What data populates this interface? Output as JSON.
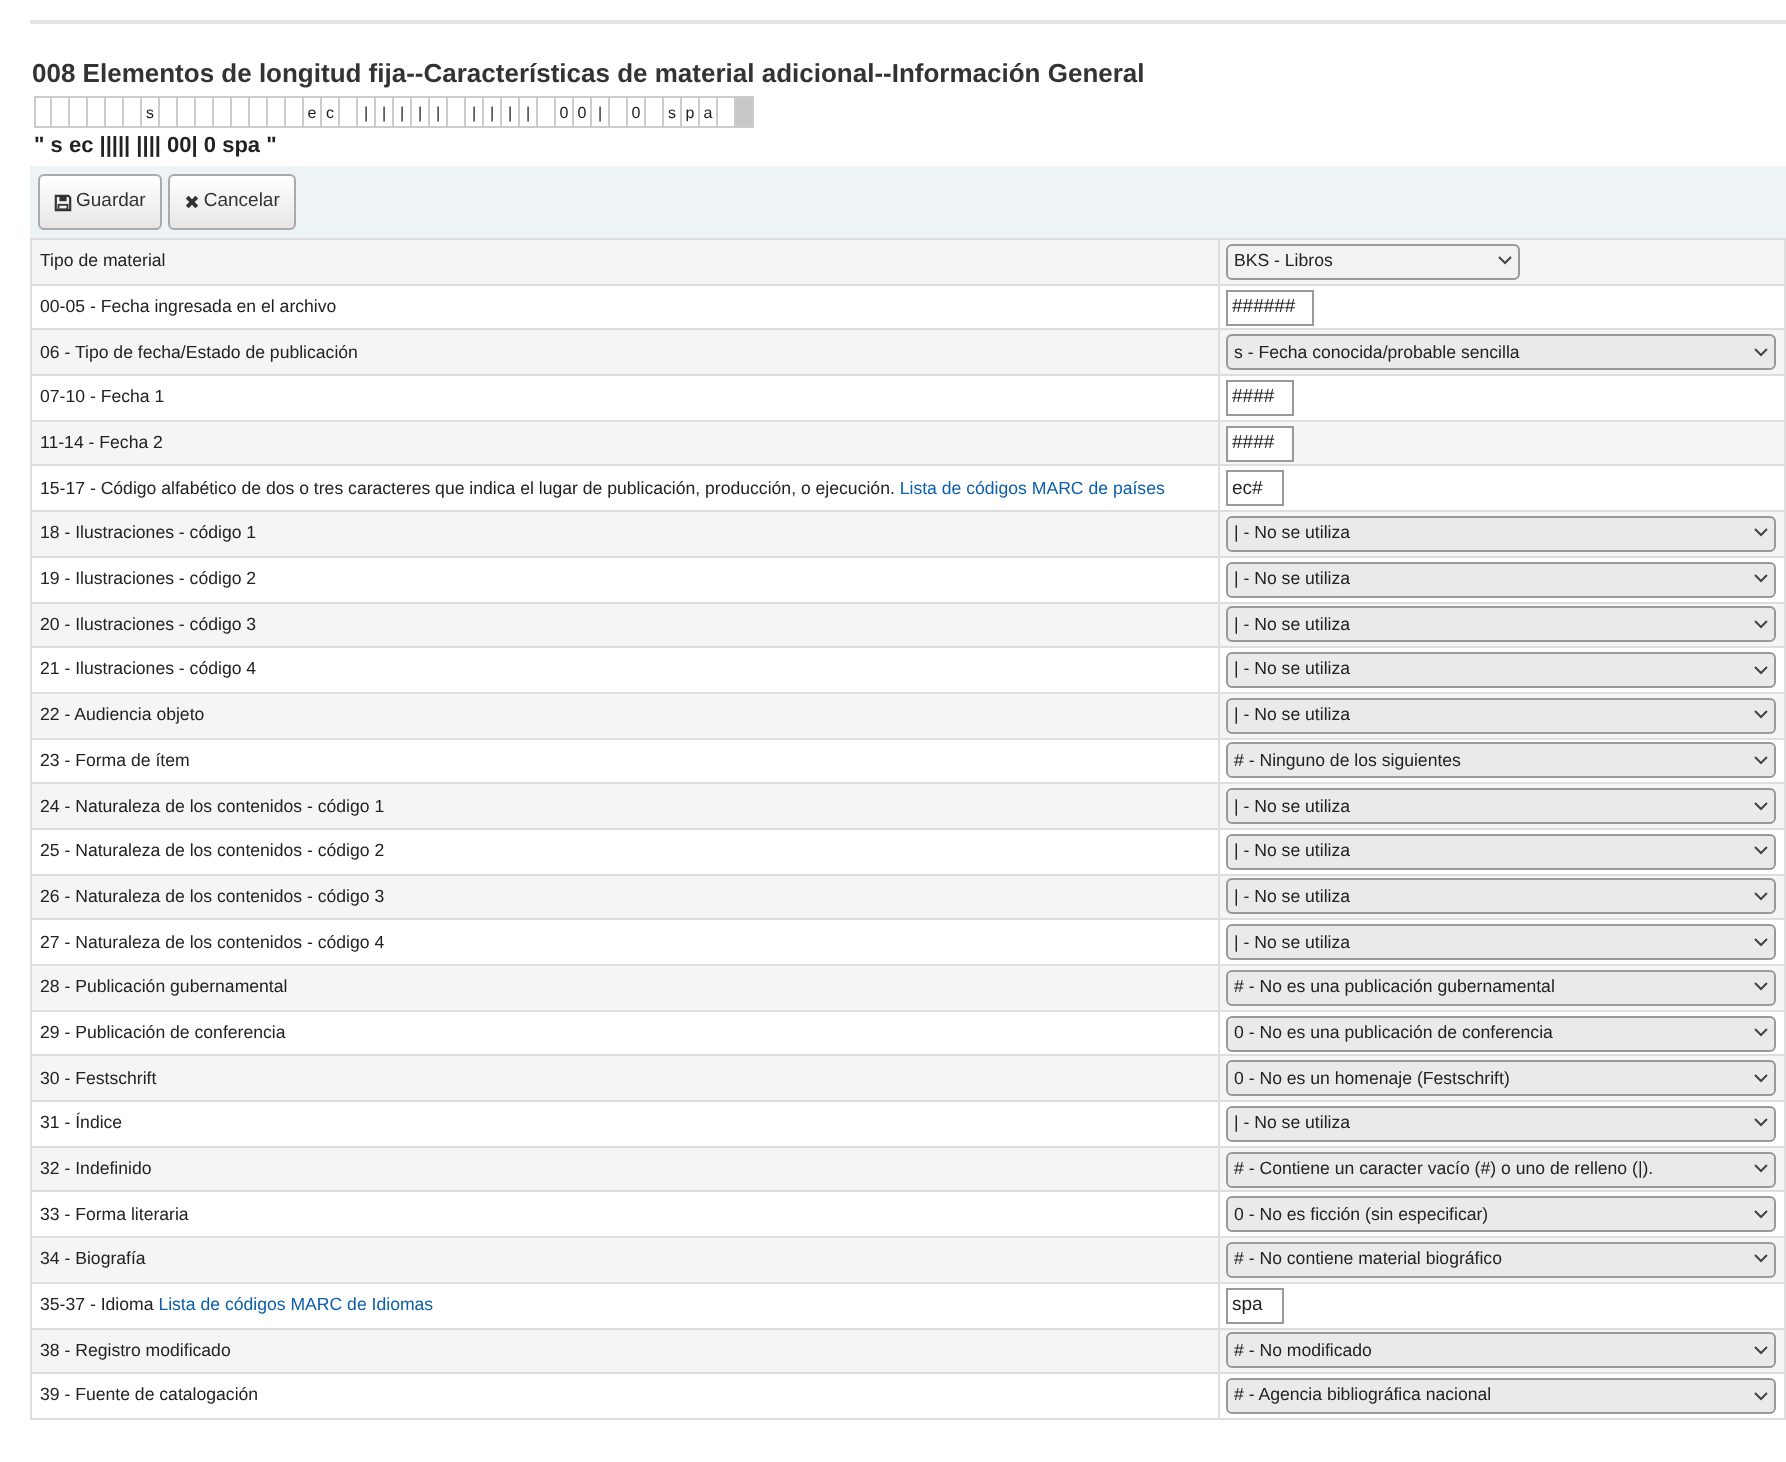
{
  "title": "008 Elementos de longitud fija--Características de material adicional--Información General",
  "cells": [
    {
      "selected": false
    },
    {
      "selected": false
    },
    {
      "selected": false
    },
    {
      "selected": false
    },
    {
      "selected": false
    },
    {
      "selected": false
    },
    {
      "char": "s",
      "selected": false
    },
    {
      "selected": false
    },
    {
      "selected": false
    },
    {
      "selected": false
    },
    {
      "selected": false
    },
    {
      "selected": false
    },
    {
      "selected": false
    },
    {
      "selected": false
    },
    {
      "selected": false
    },
    {
      "char": "e",
      "selected": false
    },
    {
      "char": "c",
      "selected": false
    },
    {
      "selected": false
    },
    {
      "char": "|",
      "selected": false
    },
    {
      "char": "|",
      "selected": false
    },
    {
      "char": "|",
      "selected": false
    },
    {
      "char": "|",
      "selected": false
    },
    {
      "char": "|",
      "selected": false
    },
    {
      "selected": false
    },
    {
      "char": "|",
      "selected": false
    },
    {
      "char": "|",
      "selected": false
    },
    {
      "char": "|",
      "selected": false
    },
    {
      "char": "|",
      "selected": false
    },
    {
      "selected": false
    },
    {
      "char": "0",
      "selected": false
    },
    {
      "char": "0",
      "selected": false
    },
    {
      "char": "|",
      "selected": false
    },
    {
      "selected": false
    },
    {
      "char": "0",
      "selected": false
    },
    {
      "selected": false
    },
    {
      "char": "s",
      "selected": false
    },
    {
      "char": "p",
      "selected": false
    },
    {
      "char": "a",
      "selected": false
    },
    {
      "selected": false
    },
    {
      "selected": true
    }
  ],
  "preview": "\" s ec ||||| |||| 00| 0 spa \"",
  "buttons": [
    {
      "kind": "save",
      "label": "Guardar"
    },
    {
      "kind": "cancel",
      "label": "Cancelar"
    }
  ],
  "rows": [
    {
      "label": "Tipo de material",
      "kind": "select-short",
      "value": "BKS - Libros"
    },
    {
      "label": "00-05 - Fecha ingresada en el archivo",
      "kind": "input",
      "value": "######"
    },
    {
      "label": "06 - Tipo de fecha/Estado de publicación",
      "kind": "select",
      "value": "s - Fecha conocida/probable sencilla"
    },
    {
      "label": "07-10 - Fecha 1",
      "kind": "input",
      "value": "####"
    },
    {
      "label": "11-14 - Fecha 2",
      "kind": "input",
      "value": "####"
    },
    {
      "label": "15-17 - Código alfabético de dos o tres caracteres que indica el lugar de publicación, producción, o ejecución.",
      "link": "Lista de códigos MARC de países",
      "kind": "input",
      "value": "ec#"
    },
    {
      "label": "18 - Ilustraciones - código 1",
      "kind": "select",
      "value": "| - No se utiliza"
    },
    {
      "label": "19 - Ilustraciones - código 2",
      "kind": "select",
      "value": "| - No se utiliza"
    },
    {
      "label": "20 - Ilustraciones - código 3",
      "kind": "select",
      "value": "| - No se utiliza"
    },
    {
      "label": "21 - Ilustraciones - código 4",
      "kind": "select",
      "value": "| - No se utiliza"
    },
    {
      "label": "22 - Audiencia objeto",
      "kind": "select",
      "value": "| - No se utiliza"
    },
    {
      "label": "23 - Forma de ítem",
      "kind": "select",
      "value": "# - Ninguno de los siguientes"
    },
    {
      "label": "24 - Naturaleza de los contenidos - código 1",
      "kind": "select",
      "value": "| - No se utiliza"
    },
    {
      "label": "25 - Naturaleza de los contenidos - código 2",
      "kind": "select",
      "value": "| - No se utiliza"
    },
    {
      "label": "26 - Naturaleza de los contenidos - código 3",
      "kind": "select",
      "value": "| - No se utiliza"
    },
    {
      "label": "27 - Naturaleza de los contenidos - código 4",
      "kind": "select",
      "value": "| - No se utiliza"
    },
    {
      "label": "28 - Publicación gubernamental",
      "kind": "select",
      "value": "# - No es una publicación gubernamental"
    },
    {
      "label": "29 - Publicación de conferencia",
      "kind": "select",
      "value": "0 - No es una publicación de conferencia"
    },
    {
      "label": "30 - Festschrift",
      "kind": "select",
      "value": "0 - No es un homenaje (Festschrift)"
    },
    {
      "label": "31 - Índice",
      "kind": "select",
      "value": "| - No se utiliza"
    },
    {
      "label": "32 - Indefinido",
      "kind": "select",
      "value": "# - Contiene un caracter vacío (#) o uno de relleno (|)."
    },
    {
      "label": "33 - Forma literaria",
      "kind": "select",
      "value": "0 - No es ficción (sin especificar)"
    },
    {
      "label": "34 - Biografía",
      "kind": "select",
      "value": "# - No contiene material biográfico"
    },
    {
      "label": "35-37 - Idioma",
      "link": "Lista de códigos MARC de Idiomas",
      "kind": "input",
      "value": "spa"
    },
    {
      "label": "38 - Registro modificado",
      "kind": "select",
      "value": "# - No modificado"
    },
    {
      "label": "39 - Fuente de catalogación",
      "kind": "select",
      "value": "# - Agencia bibliográfica nacional"
    }
  ]
}
